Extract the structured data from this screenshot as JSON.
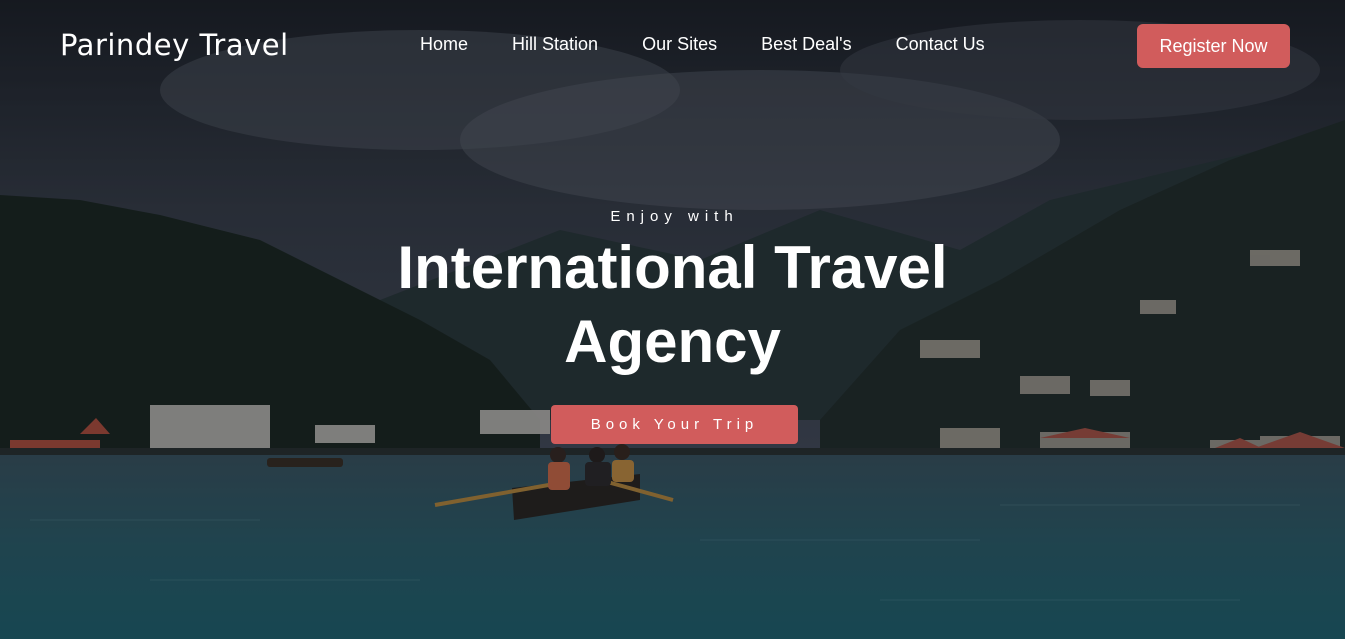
{
  "brand": {
    "name": "Parindey Travel"
  },
  "nav": {
    "items": [
      {
        "label": "Home"
      },
      {
        "label": "Hill Station"
      },
      {
        "label": "Our Sites"
      },
      {
        "label": "Best Deal's"
      },
      {
        "label": "Contact Us"
      }
    ],
    "register_label": "Register Now"
  },
  "hero": {
    "kicker": "Enjoy with",
    "headline": "International Travel Agency",
    "cta_label": "Book Your Trip"
  },
  "colors": {
    "accent": "#d15c5c",
    "sky": "#2a3039",
    "water": "#2f5f6a",
    "forest": "#1f2a22"
  },
  "background": {
    "description_icon": "lake-boat-photo"
  }
}
